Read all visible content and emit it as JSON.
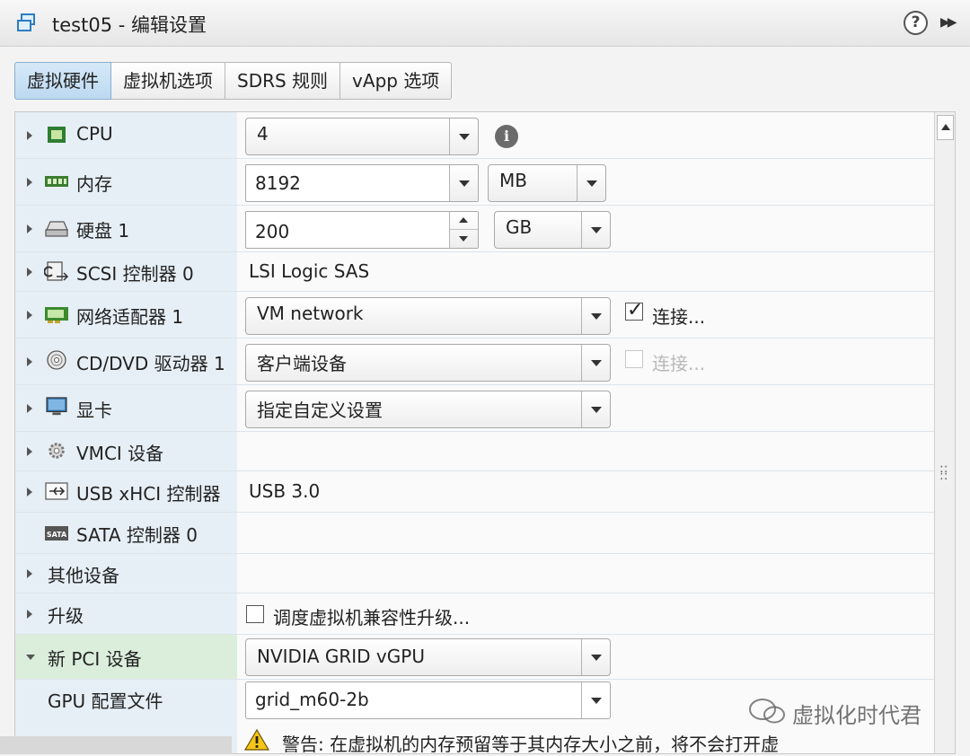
{
  "window": {
    "title": "test05 - 编辑设置",
    "help_label": "?"
  },
  "tabs": [
    {
      "label": "虚拟硬件",
      "active": true
    },
    {
      "label": "虚拟机选项"
    },
    {
      "label": "SDRS 规则"
    },
    {
      "label": "vApp 选项"
    }
  ],
  "rows": {
    "cpu": {
      "label": "CPU",
      "value": "4"
    },
    "memory": {
      "label": "内存",
      "value": "8192",
      "unit": "MB"
    },
    "disk": {
      "label": "硬盘 1",
      "value": "200",
      "unit": "GB"
    },
    "scsi": {
      "label": "SCSI 控制器 0",
      "value": "LSI Logic SAS"
    },
    "network": {
      "label": "网络适配器 1",
      "value": "VM network",
      "connect_label": "连接...",
      "connected": true
    },
    "cdrom": {
      "label": "CD/DVD 驱动器 1",
      "value": "客户端设备",
      "connect_label": "连接...",
      "connected": false
    },
    "video": {
      "label": "显卡",
      "value": "指定自定义设置"
    },
    "vmci": {
      "label": "VMCI 设备"
    },
    "usb": {
      "label": "USB xHCI 控制器",
      "value": "USB 3.0"
    },
    "sata": {
      "label": "SATA 控制器 0"
    },
    "other": {
      "label": "其他设备"
    },
    "upgrade": {
      "label": "升级",
      "check_label": "调度虚拟机兼容性升级...",
      "checked": false
    },
    "pci": {
      "label": "新 PCI 设备",
      "value": "NVIDIA GRID vGPU"
    },
    "gpu_profile": {
      "label": "GPU 配置文件",
      "value": "grid_m60-2b"
    }
  },
  "warning": {
    "text": "警告: 在虚拟机的内存预留等于其内存大小之前，将不会打开虚"
  },
  "watermark": {
    "text": "虚拟化时代君"
  },
  "colors": {
    "active_tab": "#c4ddf2",
    "label_column": "#e6eff6",
    "highlight_row": "#dbeedc"
  }
}
